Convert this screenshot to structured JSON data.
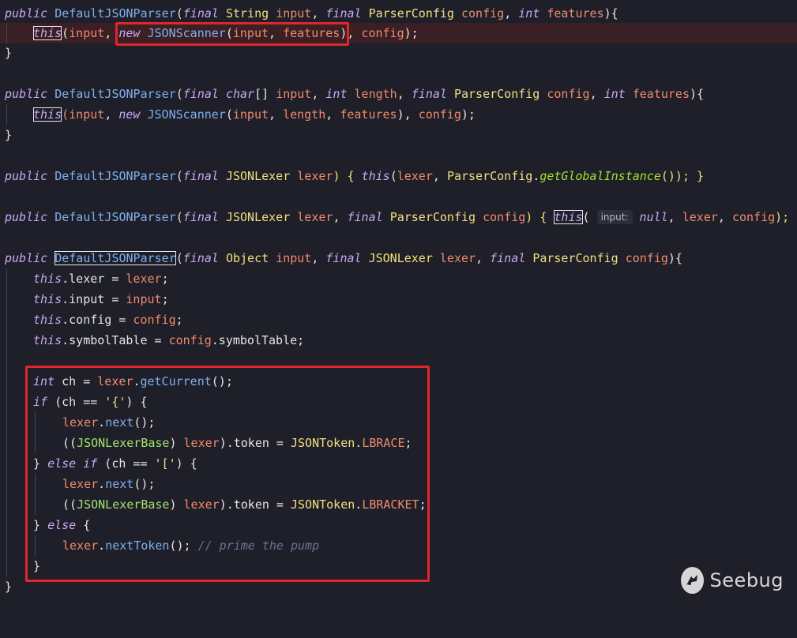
{
  "code": {
    "l1": {
      "public": "public",
      "ctor": "DefaultJSONParser",
      "open": "(",
      "final1": "final",
      "type1": "String",
      "p1": "input",
      "comma1": ", ",
      "final2": "final",
      "type2": "ParserConfig",
      "p2": "config",
      "comma2": ", ",
      "int": "int",
      "p3": "features",
      "close": "){"
    },
    "l2": {
      "this": "this",
      "open": "(",
      "a1": "input",
      "comma": ", ",
      "new": "new",
      "ctor": "JSONScanner",
      "open2": "(",
      "a2": "input",
      "comma2": ", ",
      "a3": "features",
      "close2": ")",
      "comma3": ", ",
      "a4": "config",
      "end": ");"
    },
    "l3": {
      "brace": "}"
    },
    "l5": {
      "public": "public",
      "ctor": "DefaultJSONParser",
      "open": "(",
      "final1": "final",
      "type1": "char",
      "arr": "[] ",
      "p1": "input",
      "comma1": ", ",
      "int1": "int",
      "p2": "length",
      "comma2": ", ",
      "final2": "final",
      "type2": "ParserConfig",
      "p3": "config",
      "comma3": ", ",
      "int2": "int",
      "p4": "features",
      "close": "){"
    },
    "l6": {
      "this": "this",
      "open": "(",
      "a1": "input",
      "comma": ", ",
      "new": "new",
      "ctor": "JSONScanner",
      "open2": "(",
      "a2": "input",
      "comma2": ", ",
      "a3": "length",
      "comma3": ", ",
      "a4": "features",
      "close2": ")",
      "comma4": ", ",
      "a5": "config",
      "end": ");"
    },
    "l7": {
      "brace": "}"
    },
    "l9": {
      "public": "public",
      "ctor": "DefaultJSONParser",
      "open": "(",
      "final": "final",
      "type": "JSONLexer",
      "p": "lexer",
      "mid": ") { ",
      "this": "this",
      "open2": "(",
      "a1": "lexer",
      "comma": ", ",
      "cls": "ParserConfig",
      "dot": ".",
      "m": "getGlobalInstance",
      "end": "()); }"
    },
    "l11": {
      "public": "public",
      "ctor": "DefaultJSONParser",
      "open": "(",
      "final1": "final",
      "type1": "JSONLexer",
      "p1": "lexer",
      "comma1": ", ",
      "final2": "final",
      "type2": "ParserConfig",
      "p2": "config",
      "mid": ") { ",
      "this": "this",
      "open2": "(",
      "hint": "input:",
      "null": "null",
      "comma2": ", ",
      "a2": "lexer",
      "comma3": ", ",
      "a3": "config",
      "end": "); }"
    },
    "l13": {
      "public": "public",
      "ctor": "DefaultJSONParser",
      "open": "(",
      "final1": "final",
      "type1": "Object",
      "p1": "input",
      "comma1": ", ",
      "final2": "final",
      "type2": "JSONLexer",
      "p2": "lexer",
      "comma2": ", ",
      "final3": "final",
      "type3": "ParserConfig",
      "p3": "config",
      "close": "){"
    },
    "l14": {
      "this": "this",
      "field": ".lexer",
      "eq": " = ",
      "v": "lexer",
      "end": ";"
    },
    "l15": {
      "this": "this",
      "field": ".input",
      "eq": " = ",
      "v": "input",
      "end": ";"
    },
    "l16": {
      "this": "this",
      "field": ".config",
      "eq": " = ",
      "v": "config",
      "end": ";"
    },
    "l17": {
      "this": "this",
      "field": ".symbolTable",
      "eq": " = ",
      "v": "config",
      "rest": ".symbolTable",
      "end": ";"
    },
    "l19": {
      "int": "int",
      "rest1": " ch = ",
      "v": "lexer",
      "dot": ".",
      "m": "getCurrent",
      "end": "();"
    },
    "l20": {
      "if": "if",
      "rest1": " (ch == ",
      "lit": "'{'",
      "end": ") {"
    },
    "l21": {
      "v": "lexer",
      "dot": ".",
      "m": "next",
      "end": "();"
    },
    "l22": {
      "open": "((",
      "cls": "JSONLexerBase",
      "sp": ") ",
      "v": "lexer",
      "rest": ").token = ",
      "cls2": "JSONToken",
      "dot": ".",
      "c": "LBRACE",
      "end": ";"
    },
    "l23": {
      "pre": "} ",
      "else": "else",
      "sp": " ",
      "if": "if",
      "rest1": " (ch == ",
      "lit": "'['",
      "end": ") {"
    },
    "l24": {
      "v": "lexer",
      "dot": ".",
      "m": "next",
      "end": "();"
    },
    "l25": {
      "open": "((",
      "cls": "JSONLexerBase",
      "sp": ") ",
      "v": "lexer",
      "rest": ").token = ",
      "cls2": "JSONToken",
      "dot": ".",
      "c": "LBRACKET",
      "end": ";"
    },
    "l26": {
      "pre": "} ",
      "else": "else",
      "end": " {"
    },
    "l27": {
      "v": "lexer",
      "dot": ".",
      "m": "nextToken",
      "mid": "(); ",
      "cmt": "// prime the pump"
    },
    "l28": {
      "brace": "}"
    },
    "l29": {
      "brace": "}"
    }
  },
  "watermark": {
    "text": "Seebug",
    "icon": "seebug-bug-logo"
  },
  "colors": {
    "background": "#1e1f29",
    "keyword": "#c9a9f5",
    "type": "#f1e07e",
    "function": "#7fb0f0",
    "variable": "#f28b6c",
    "highlight_box": "#e0262c"
  }
}
